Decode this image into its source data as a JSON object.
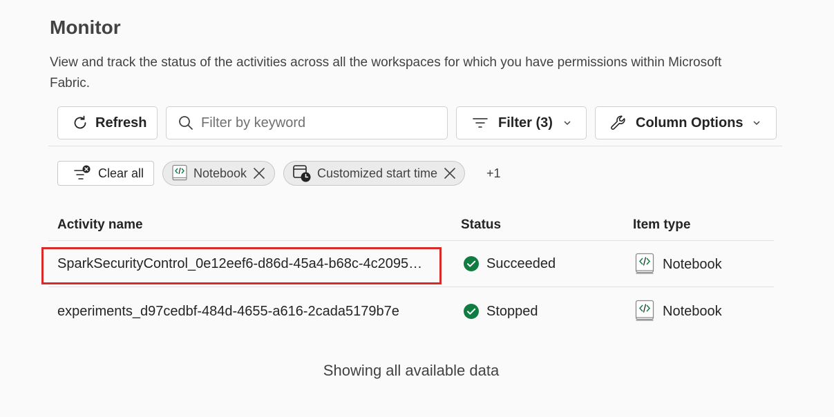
{
  "page": {
    "title": "Monitor",
    "description": "View and track the status of the activities across all the workspaces for which you have permissions within Microsoft Fabric."
  },
  "toolbar": {
    "refresh_label": "Refresh",
    "search_placeholder": "Filter by keyword",
    "filter_label": "Filter (3)",
    "column_options_label": "Column Options"
  },
  "filters": {
    "clear_all_label": "Clear all",
    "chips": [
      {
        "label": "Notebook",
        "icon": "notebook-icon"
      },
      {
        "label": "Customized start time",
        "icon": "calendar-clock-icon"
      }
    ],
    "more_label": "+1"
  },
  "table": {
    "columns": [
      "Activity name",
      "Status",
      "Item type"
    ],
    "rows": [
      {
        "name": "SparkSecurityControl_0e12eef6-d86d-45a4-b68c-4c2095…",
        "status": "Succeeded",
        "item_type": "Notebook",
        "highlighted": true
      },
      {
        "name": "experiments_d97cedbf-484d-4655-a616-2cada5179b7e",
        "status": "Stopped",
        "item_type": "Notebook",
        "highlighted": false
      }
    ]
  },
  "footer": {
    "text": "Showing all available data"
  },
  "colors": {
    "success": "#107c41",
    "highlight": "#d92a2a"
  }
}
